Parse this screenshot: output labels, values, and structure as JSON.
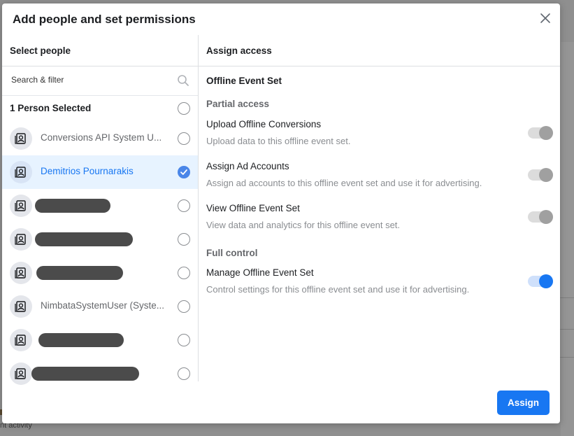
{
  "dialog": {
    "title": "Add people and set permissions",
    "assign_label": "Assign"
  },
  "left": {
    "header": "Select people",
    "search_placeholder": "Search & filter",
    "selected_count_label": "1 Person Selected",
    "people": [
      {
        "name": "Conversions API System U...",
        "selected": false,
        "redacted": false
      },
      {
        "name": "Demitrios Pournarakis",
        "selected": true,
        "redacted": false
      },
      {
        "name": "",
        "selected": false,
        "redacted": true
      },
      {
        "name": "",
        "selected": false,
        "redacted": true
      },
      {
        "name": "",
        "selected": false,
        "redacted": true
      },
      {
        "name": "NimbataSystemUser (Syste...",
        "selected": false,
        "redacted": false
      },
      {
        "name": "",
        "selected": false,
        "redacted": true
      },
      {
        "name": "",
        "selected": false,
        "redacted": true
      }
    ]
  },
  "right": {
    "header": "Assign access",
    "section_title": "Offline Event Set",
    "partial_label": "Partial access",
    "full_label": "Full control",
    "permissions": [
      {
        "title": "Upload Offline Conversions",
        "description": "Upload data to this offline event set.",
        "enabled": false
      },
      {
        "title": "Assign Ad Accounts",
        "description": "Assign ad accounts to this offline event set and use it for advertising.",
        "enabled": false
      },
      {
        "title": "View Offline Event Set",
        "description": "View data and analytics for this offline event set.",
        "enabled": false
      },
      {
        "title": "Manage Offline Event Set",
        "description": "Control settings for this offline event set and use it for advertising.",
        "enabled": true
      }
    ]
  },
  "background": {
    "footer_text": "nt activity"
  },
  "colors": {
    "accent": "#1877f2",
    "selected_row_bg": "#e7f3ff",
    "redaction": "#4b4b4b"
  }
}
